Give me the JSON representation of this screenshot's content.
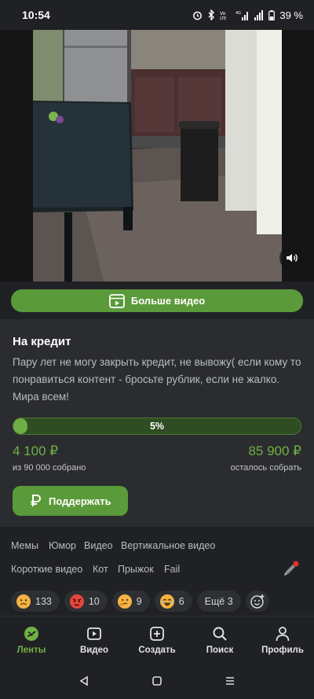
{
  "status_bar": {
    "time": "10:54",
    "battery": "39 %",
    "network": "4G"
  },
  "video": {
    "alt": "kitchen video frame"
  },
  "more_videos": {
    "label": "Больше видео"
  },
  "post": {
    "title": "На кредит",
    "text": "Пару лет не могу закрыть кредит, не вывожу( если кому то понравиться контент - бросьте рублик, если не жалко. Мира всем!"
  },
  "fundraiser": {
    "progress_fraction": 0.05,
    "progress_label": "5%",
    "collected": "4 100 ₽",
    "collected_caption": "из 90 000 собрано",
    "remaining": "85 900 ₽",
    "remaining_caption": "осталось собрать",
    "support_label": "Поддержать"
  },
  "tags": {
    "row1": [
      "Мемы",
      "Юмор",
      "Видео",
      "Вертикальное видео"
    ],
    "row2": [
      "Короткие видео",
      "Кот",
      "Прыжок",
      "Fail"
    ]
  },
  "reactions": [
    {
      "icon": "sad-face-icon",
      "count": "133"
    },
    {
      "icon": "angry-face-icon",
      "count": "10"
    },
    {
      "icon": "thinking-face-icon",
      "count": "9"
    },
    {
      "icon": "laughing-face-icon",
      "count": "6"
    }
  ],
  "reactions_more": "Ещё 3",
  "tabbar": {
    "feeds": "Ленты",
    "video": "Видео",
    "create": "Создать",
    "search": "Поиск",
    "profile": "Профиль"
  },
  "colors": {
    "accent": "#5b9a3a",
    "accent_text": "#6fb244",
    "background": "#202124",
    "card": "#2b2c2f"
  }
}
